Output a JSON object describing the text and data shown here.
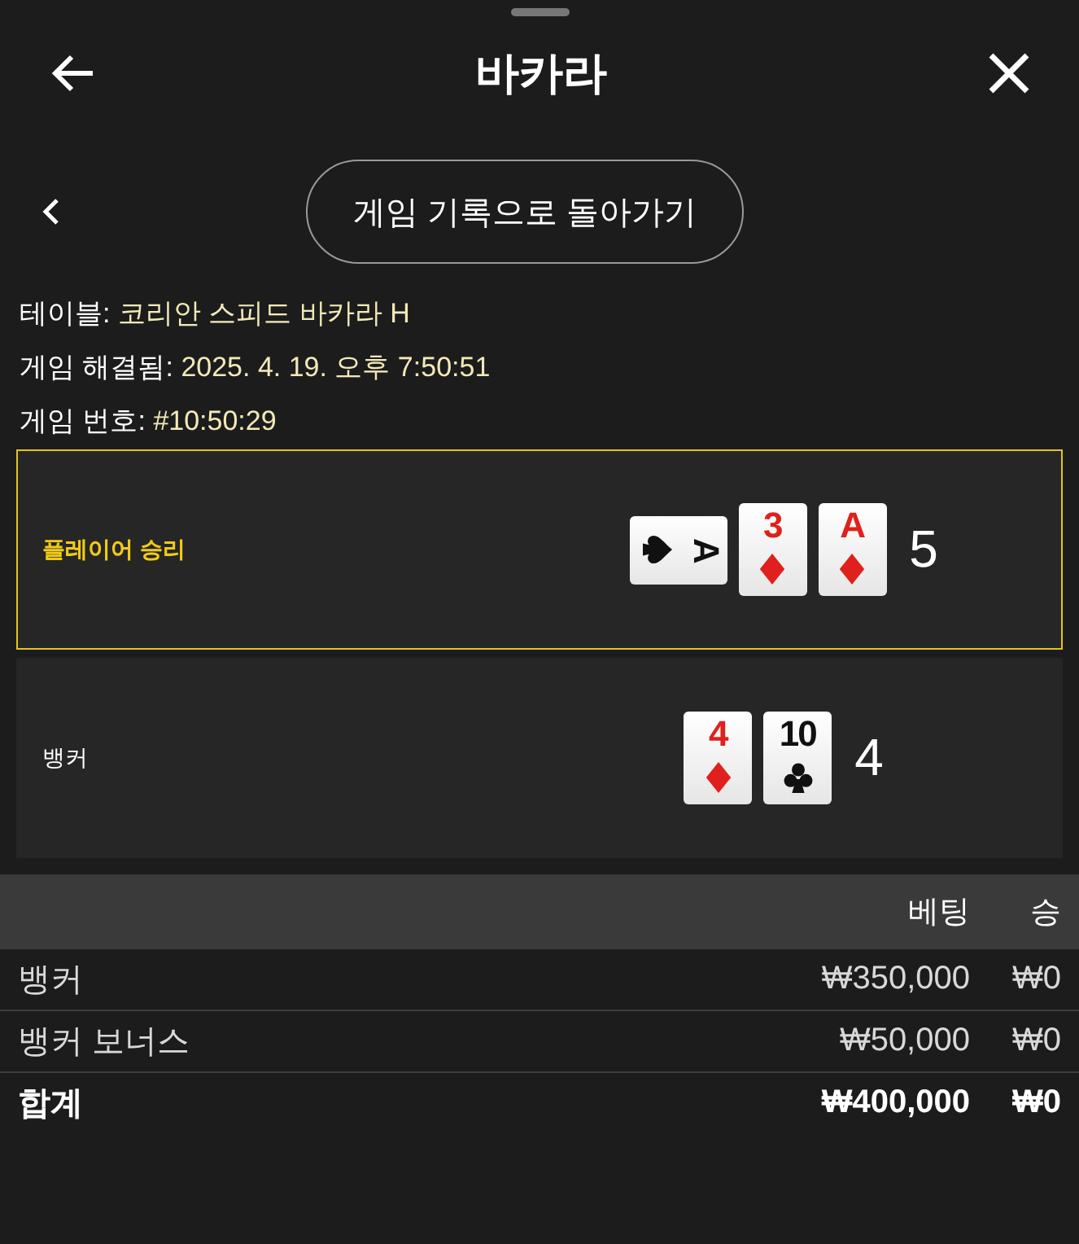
{
  "header": {
    "title": "바카라"
  },
  "nav": {
    "button": "게임 기록으로 돌아가기"
  },
  "info": [
    {
      "label": "테이블:",
      "value": "코리안 스피드 바카라 H"
    },
    {
      "label": "게임 해결됨:",
      "value": "2025. 4. 19. 오후 7:50:51"
    },
    {
      "label": "게임 번호:",
      "value": "#10:50:29"
    }
  ],
  "hands": [
    {
      "label": "플레이어 승리",
      "winner": true,
      "total": "5",
      "cards": [
        {
          "rank": "A",
          "kind": "spade",
          "rotated": true
        },
        {
          "rank": "3",
          "kind": "diamond",
          "rotated": false
        },
        {
          "rank": "A",
          "kind": "diamond",
          "rotated": false
        }
      ]
    },
    {
      "label": "뱅커",
      "winner": false,
      "total": "4",
      "cards": [
        {
          "rank": "4",
          "kind": "diamond",
          "rotated": false
        },
        {
          "rank": "10",
          "kind": "club",
          "rotated": false
        }
      ]
    }
  ],
  "table": {
    "columns": [
      "베팅",
      "승"
    ],
    "rows": [
      {
        "name": "뱅커",
        "bet": "₩350,000",
        "win": "₩0",
        "kind": "item"
      },
      {
        "name": "뱅커 보너스",
        "bet": "₩50,000",
        "win": "₩0",
        "kind": "item"
      },
      {
        "name": "합계",
        "bet": "₩400,000",
        "win": "₩0",
        "kind": "total"
      }
    ]
  }
}
